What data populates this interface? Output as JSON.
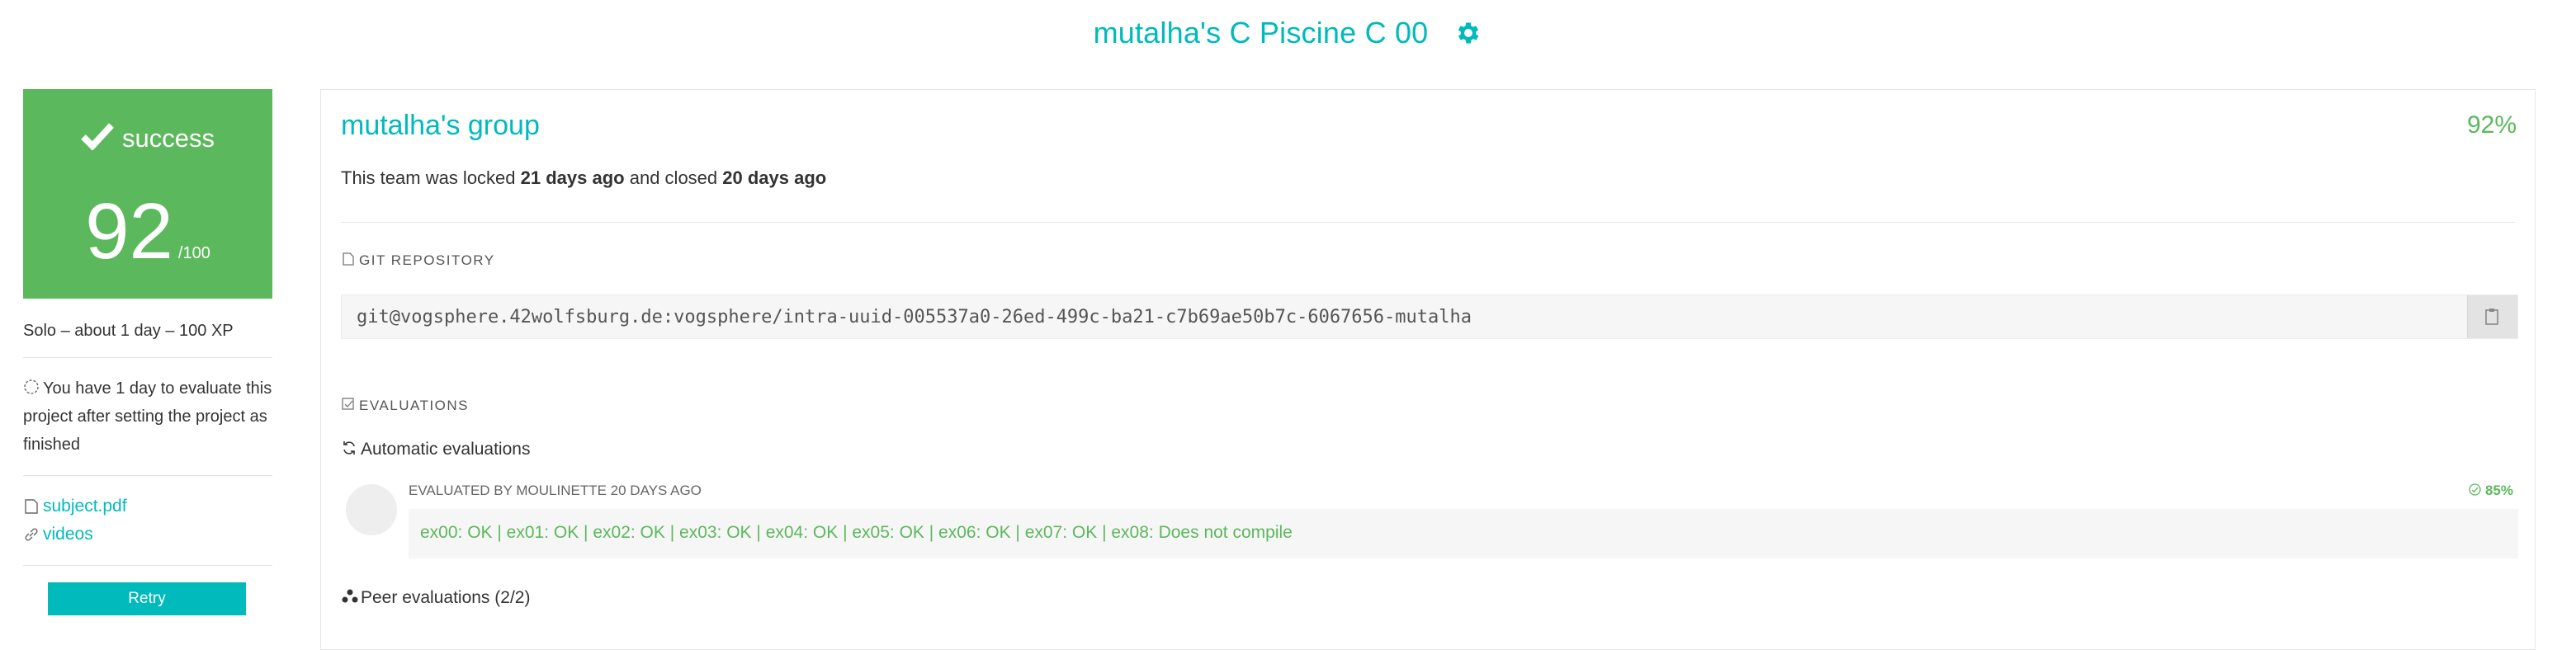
{
  "header": {
    "title": "mutalha's C Piscine C 00",
    "settings_icon": "gear-icon",
    "accent": "#00babc"
  },
  "sidebar": {
    "status": "success",
    "status_color": "#5cb85c",
    "score": "92",
    "score_max": "/100",
    "meta": "Solo – about 1 day – 100 XP",
    "eval_notice": "You have 1 day to evaluate this project after setting the project as finished",
    "links": [
      {
        "label": "subject.pdf",
        "icon": "file-icon"
      },
      {
        "label": "videos",
        "icon": "link-icon"
      }
    ],
    "retry_label": "Retry"
  },
  "team": {
    "name": "mutalha's group",
    "percent": "92%",
    "locked_prefix": "This team was locked",
    "locked_when": "21 days ago",
    "closed_prefix": "and closed",
    "closed_when": "20 days ago"
  },
  "git": {
    "heading": "GIT REPOSITORY",
    "url": "git@vogsphere.42wolfsburg.de:vogsphere/intra-uuid-005537a0-26ed-499c-ba21-c7b69ae50b7c-6067656-mutalha"
  },
  "evaluations": {
    "heading": "EVALUATIONS",
    "automatic_heading": "Automatic evaluations",
    "automatic": {
      "evaluated_by": "EVALUATED BY MOULINETTE 20 DAYS AGO",
      "percent": "85%",
      "result": "ex00: OK | ex01: OK | ex02: OK | ex03: OK | ex04: OK | ex05: OK | ex06: OK | ex07: OK | ex08: Does not compile"
    },
    "peer_heading": "Peer evaluations (2/2)"
  }
}
